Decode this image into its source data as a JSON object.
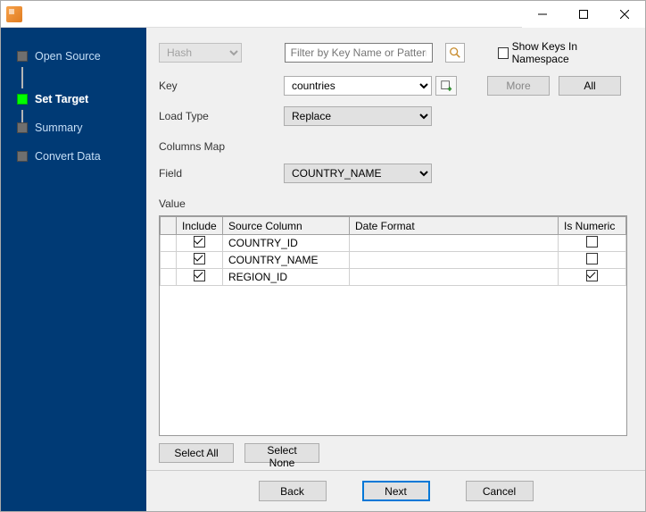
{
  "titlebar": {
    "title": ""
  },
  "sidebar": {
    "steps": [
      {
        "label": "Open Source",
        "active": false
      },
      {
        "label": "Set Target",
        "active": true
      },
      {
        "label": "Summary",
        "active": false
      },
      {
        "label": "Convert Data",
        "active": false
      }
    ]
  },
  "toolbar": {
    "type_value": "Hash",
    "filter_placeholder": "Filter by Key Name or Pattern",
    "show_keys_label": "Show Keys In Namespace",
    "show_keys_checked": false,
    "more_label": "More",
    "all_label": "All"
  },
  "form": {
    "key_label": "Key",
    "key_value": "countries",
    "loadtype_label": "Load Type",
    "loadtype_value": "Replace",
    "columns_map_label": "Columns Map",
    "field_label": "Field",
    "field_value": "COUNTRY_NAME",
    "value_label": "Value"
  },
  "grid": {
    "headers": {
      "include": "Include",
      "source": "Source Column",
      "dateformat": "Date Format",
      "isnumeric": "Is Numeric"
    },
    "rows": [
      {
        "include": true,
        "source": "COUNTRY_ID",
        "dateformat": "",
        "isnumeric": false
      },
      {
        "include": true,
        "source": "COUNTRY_NAME",
        "dateformat": "",
        "isnumeric": false
      },
      {
        "include": true,
        "source": "REGION_ID",
        "dateformat": "",
        "isnumeric": true
      }
    ]
  },
  "selection": {
    "select_all": "Select All",
    "select_none": "Select None"
  },
  "footer": {
    "back": "Back",
    "next": "Next",
    "cancel": "Cancel"
  }
}
